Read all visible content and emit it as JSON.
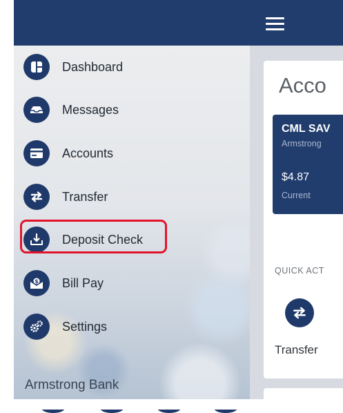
{
  "nav": {
    "items": [
      {
        "label": "Dashboard",
        "icon": "dashboard-icon"
      },
      {
        "label": "Messages",
        "icon": "messages-icon"
      },
      {
        "label": "Accounts",
        "icon": "accounts-icon"
      },
      {
        "label": "Transfer",
        "icon": "transfer-icon"
      },
      {
        "label": "Deposit Check",
        "icon": "deposit-check-icon",
        "highlighted": true
      },
      {
        "label": "Bill Pay",
        "icon": "bill-pay-icon"
      },
      {
        "label": "Settings",
        "icon": "settings-icon"
      }
    ],
    "bank_name": "Armstrong Bank"
  },
  "main": {
    "title": "Acco",
    "account": {
      "name": "CML SAV",
      "bank": "Armstrong",
      "balance": "$4.87",
      "balance_label": "Current"
    },
    "quick_actions_heading": "QUICK ACT",
    "quick_action": {
      "label": "Transfer",
      "icon": "transfer-icon"
    }
  },
  "colors": {
    "navy": "#1f3a6a",
    "topbar": "#213d6e",
    "highlight": "#e3122b"
  }
}
